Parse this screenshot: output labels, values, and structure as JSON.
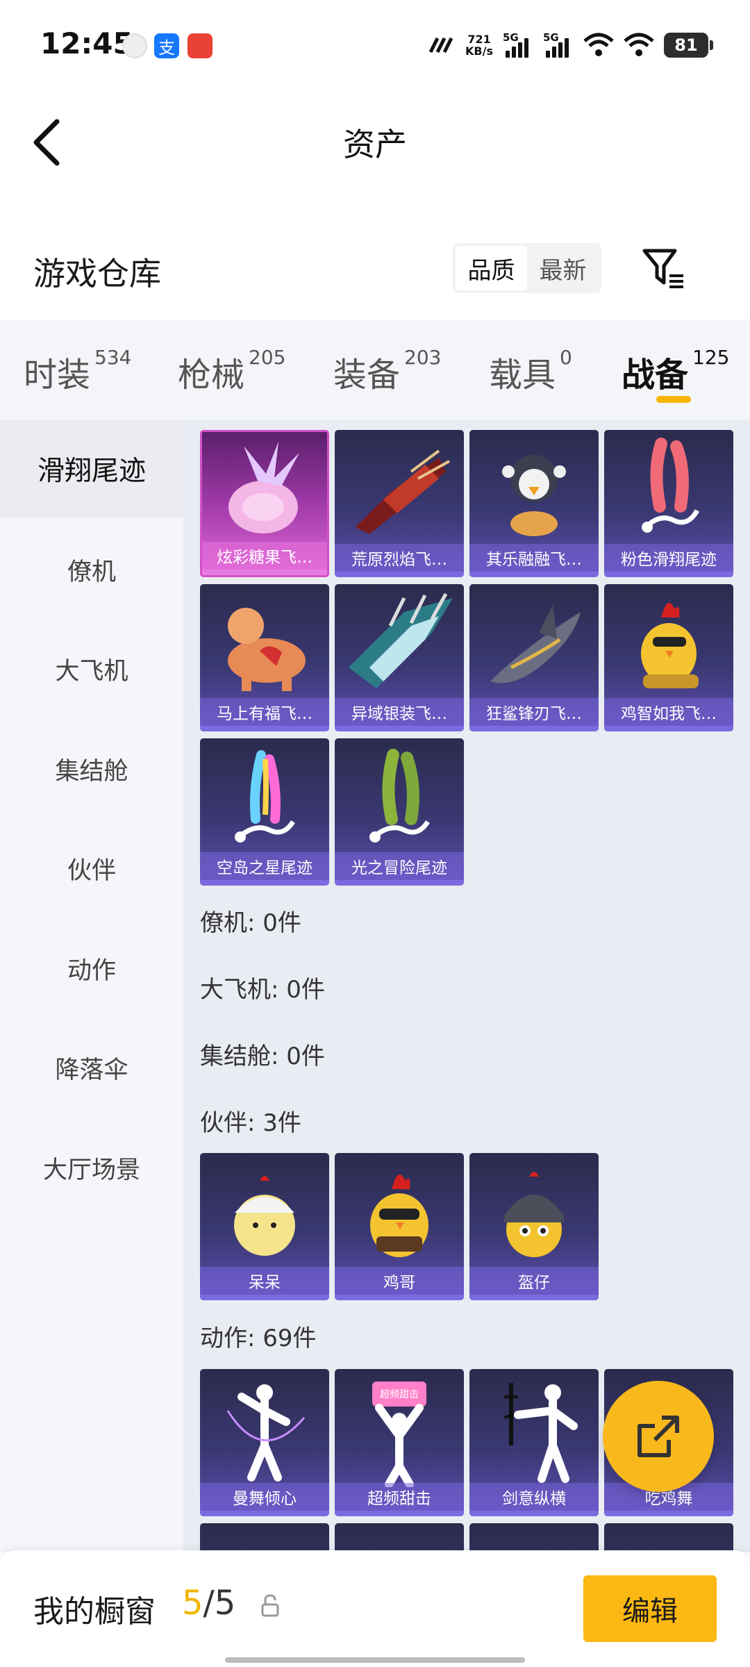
{
  "status_bar": {
    "time": "12:45",
    "net_speed_value": "721",
    "net_speed_unit": "KB/s",
    "signal1_label": "5G",
    "signal2_label": "5G",
    "battery": "81",
    "app_icons": [
      "avatar-icon",
      "alipay-icon",
      "notification-app-icon"
    ]
  },
  "header": {
    "title": "资产"
  },
  "warehouse": {
    "title": "游戏仓库",
    "sort_options": [
      "品质",
      "最新"
    ],
    "sort_selected": "品质"
  },
  "tabs": [
    {
      "label": "时装",
      "count": "534"
    },
    {
      "label": "枪械",
      "count": "205"
    },
    {
      "label": "装备",
      "count": "203"
    },
    {
      "label": "载具",
      "count": "0"
    },
    {
      "label": "战备",
      "count": "125",
      "active": true
    }
  ],
  "sidebar": {
    "items": [
      "滑翔尾迹",
      "僚机",
      "大飞机",
      "集结舱",
      "伙伴",
      "动作",
      "降落伞",
      "大厅场景"
    ],
    "active": "滑翔尾迹"
  },
  "sections": {
    "glide_trails": [
      "炫彩糖果飞…",
      "荒原烈焰飞…",
      "其乐融融飞…",
      "粉色滑翔尾迹",
      "马上有福飞…",
      "异域银装飞…",
      "狂鲨锋刃飞…",
      "鸡智如我飞…",
      "空岛之星尾迹",
      "光之冒险尾迹"
    ],
    "wingman_label": "僚机: 0件",
    "big_plane_label": "大飞机: 0件",
    "assembly_pod_label": "集结舱: 0件",
    "partner_label": "伙伴: 3件",
    "partners": [
      "呆呆",
      "鸡哥",
      "盔仔"
    ],
    "emote_label": "动作: 69件",
    "emotes": [
      "曼舞倾心",
      "超频甜击",
      "剑意纵横",
      "吃鸡舞"
    ],
    "emote_sign_text": "超频甜击"
  },
  "bottom_bar": {
    "showcase_label": "我的橱窗",
    "showcase_current": "5",
    "showcase_total": "/5",
    "edit_label": "编辑"
  },
  "colors": {
    "accent": "#f7b500",
    "card_purple": "#3a3872",
    "card_pink": "#d24fc6"
  }
}
